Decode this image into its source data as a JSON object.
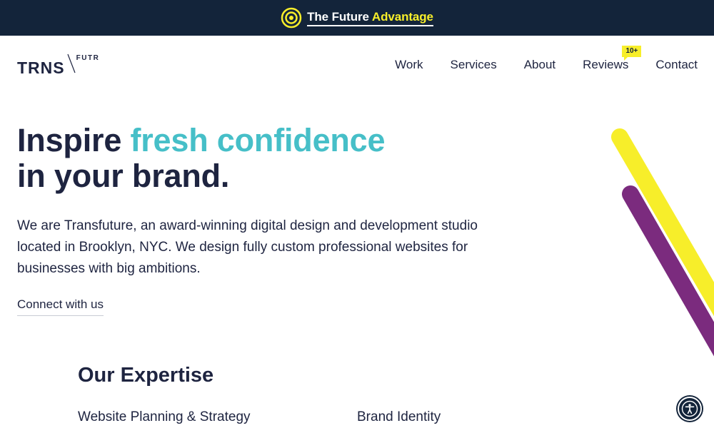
{
  "banner": {
    "text_main": "The Future",
    "text_accent": "Advantage",
    "icon": "target-icon"
  },
  "header": {
    "logo_main": "TRNS",
    "logo_sub": "FUTR",
    "nav": [
      {
        "label": "Work"
      },
      {
        "label": "Services"
      },
      {
        "label": "About"
      },
      {
        "label": "Reviews",
        "badge": "10+"
      },
      {
        "label": "Contact"
      }
    ]
  },
  "hero": {
    "headline_part1": "Inspire ",
    "headline_accent": "fresh confidence",
    "headline_line2": "in your brand.",
    "intro": "We are Transfuture, an award-winning digital design and development studio located in Brooklyn, NYC. We design fully custom professional websites for businesses with big ambitions.",
    "cta_label": "Connect with us"
  },
  "expertise": {
    "title": "Our Expertise",
    "items": [
      "Website Planning & Strategy",
      "Brand Identity"
    ]
  },
  "accessibility": {
    "icon": "accessibility-icon"
  },
  "colors": {
    "navy": "#13243a",
    "text": "#1e2440",
    "teal": "#46bfc8",
    "yellow": "#f7ee2a",
    "purple": "#7b2b7e"
  }
}
